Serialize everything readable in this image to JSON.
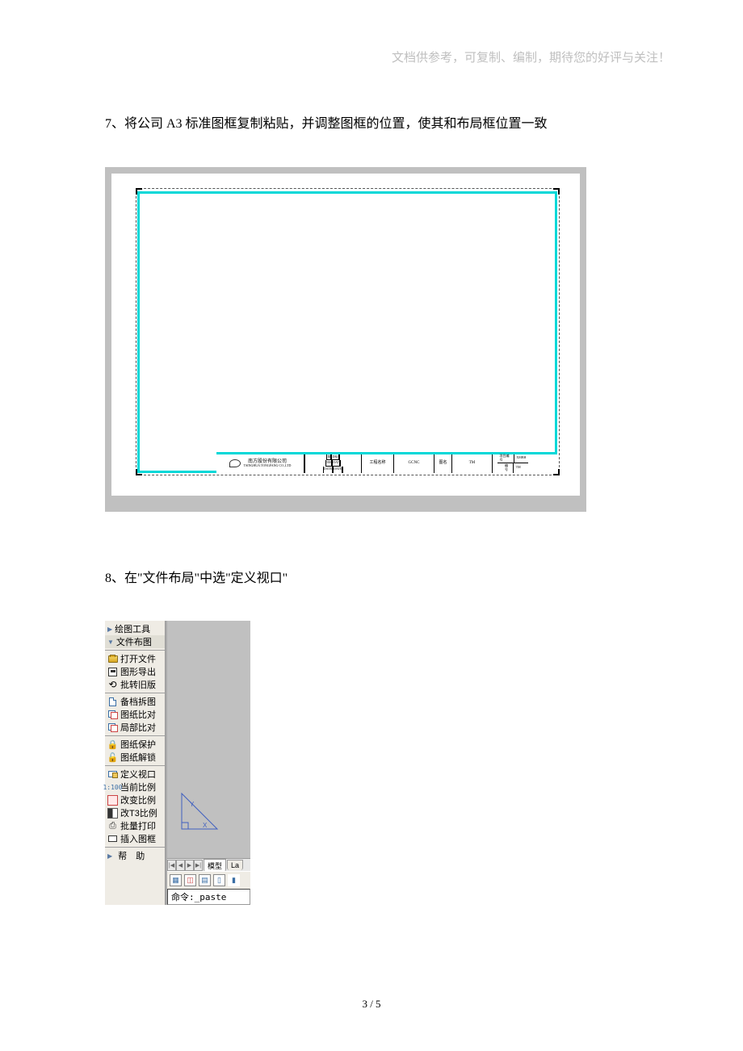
{
  "header_note": "文档供参考，可复制、编制，期待您的好评与关注！",
  "step7": "7、将公司 A3 标准图框复制粘贴，并调整图框的位置，使其和布局框位置一致",
  "step8": "8、在\"文件布局\"中选\"定义视口\"",
  "page_num": "3 / 5",
  "title_block": {
    "company_zh": "南方股份有限公司",
    "company_en": "TSINGHUA TONGFANG CO.,LTD",
    "grid": {
      "r1": [
        "",
        "批",
        "",
        "DRJ"
      ],
      "r2": [
        "",
        "580",
        "",
        "DAT"
      ],
      "r3": [
        "",
        "DATE",
        "",
        "DATE"
      ]
    },
    "label1": "工程名称",
    "val1": "GCNC",
    "small1": "图名",
    "val2": "TM",
    "end": {
      "r1": [
        "项目编号",
        "XMBH"
      ],
      "r2": [
        "编 号",
        "TM"
      ]
    }
  },
  "tool_panel": {
    "header": [
      {
        "tri": "▶",
        "label": "绘图工具"
      },
      {
        "tri": "▼",
        "label": "文件布图"
      }
    ],
    "g1": [
      {
        "icon": "folder",
        "label": "打开文件"
      },
      {
        "icon": "disk",
        "label": "图形导出"
      },
      {
        "icon": "rotate",
        "label": "批转旧版"
      }
    ],
    "g2": [
      {
        "icon": "doc",
        "label": "备档拆图"
      },
      {
        "icon": "compare",
        "label": "图纸比对"
      },
      {
        "icon": "compare",
        "label": "局部比对"
      }
    ],
    "g3": [
      {
        "icon": "lock",
        "label": "图纸保护"
      },
      {
        "icon": "unlock",
        "label": "图纸解锁"
      }
    ],
    "g4": [
      {
        "icon": "viewport",
        "label": "定义视口"
      },
      {
        "icon": "scale",
        "label": "当前比例"
      },
      {
        "icon": "scale",
        "label": "改变比例"
      },
      {
        "icon": "scale",
        "label": "改T3比例"
      },
      {
        "icon": "print",
        "label": "批量打印"
      },
      {
        "icon": "frame",
        "label": "插入图框"
      }
    ],
    "footer": [
      {
        "tri": "▶",
        "label": "帮  助"
      }
    ]
  },
  "canvas": {
    "tri_labels": {
      "y": "Y",
      "x": "X"
    },
    "tabs": {
      "nav": [
        "|◀",
        "◀",
        "▶",
        "▶|"
      ],
      "active": "模型",
      "other": "La"
    },
    "cmd_prefix": "命令:",
    "cmd_text": " _paste"
  }
}
